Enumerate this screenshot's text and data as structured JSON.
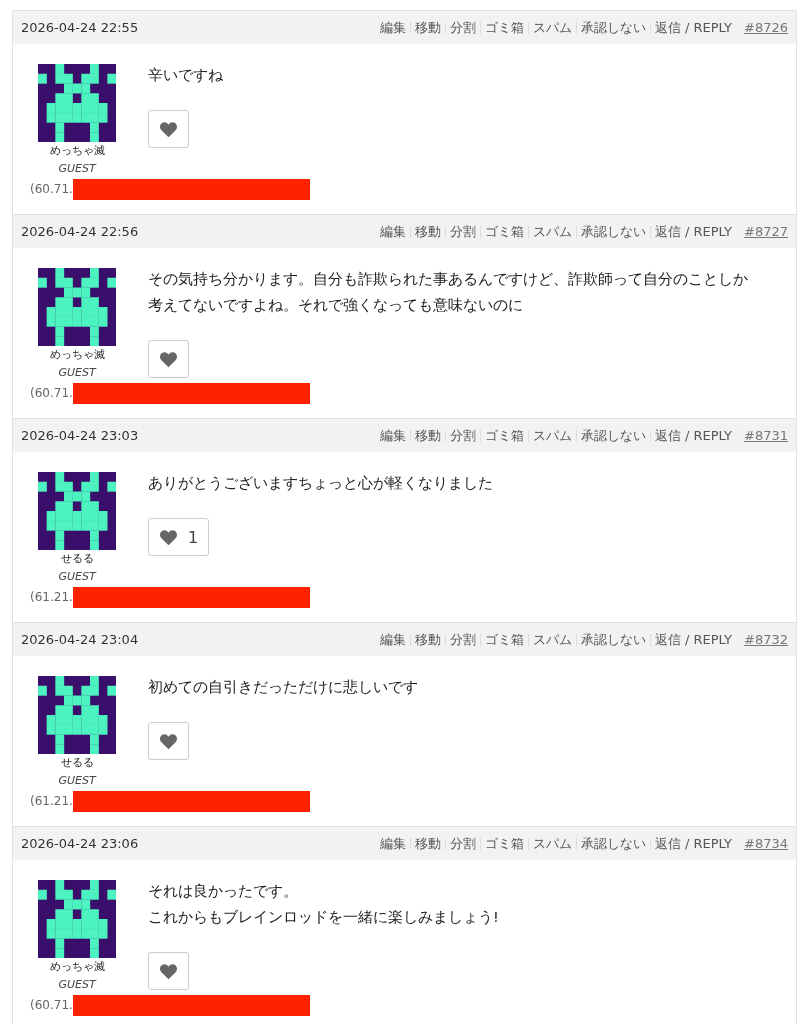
{
  "comments": [
    {
      "date": "2026-04-24 22:55",
      "actions": [
        "編集",
        "移動",
        "分割",
        "ゴミ箱",
        "スパム",
        "承認しない",
        "返信 / REPLY"
      ],
      "number": "#8726",
      "body": [
        "辛いですね"
      ],
      "author": "めっちゃ滅",
      "role": "GUEST",
      "ip": "(60.71."
    },
    {
      "date": "2026-04-24 22:56",
      "actions": [
        "編集",
        "移動",
        "分割",
        "ゴミ箱",
        "スパム",
        "承認しない",
        "返信 / REPLY"
      ],
      "number": "#8727",
      "body": [
        "その気持ち分かります。自分も詐欺られた事あるんですけど、詐欺師って自分のことしか考えてないですよね。それで強くなっても意味ないのに"
      ],
      "author": "めっちゃ滅",
      "role": "GUEST",
      "ip": "(60.71."
    },
    {
      "date": "2026-04-24 23:03",
      "actions": [
        "編集",
        "移動",
        "分割",
        "ゴミ箱",
        "スパム",
        "承認しない",
        "返信 / REPLY"
      ],
      "number": "#8731",
      "body": [
        "ありがとうございますちょっと心が軽くなりました"
      ],
      "likes": "1",
      "author": "せるる",
      "role": "GUEST",
      "ip": "(61.21."
    },
    {
      "date": "2026-04-24 23:04",
      "actions": [
        "編集",
        "移動",
        "分割",
        "ゴミ箱",
        "スパム",
        "承認しない",
        "返信 / REPLY"
      ],
      "number": "#8732",
      "body": [
        "初めての自引きだっただけに悲しいです"
      ],
      "author": "せるる",
      "role": "GUEST",
      "ip": "(61.21."
    },
    {
      "date": "2026-04-24 23:06",
      "actions": [
        "編集",
        "移動",
        "分割",
        "ゴミ箱",
        "スパム",
        "承認しない",
        "返信 / REPLY"
      ],
      "number": "#8734",
      "body": [
        "それは良かったです。",
        "これからもブレインロッドを一緒に楽しみましょう!"
      ],
      "author": "めっちゃ滅",
      "role": "GUEST",
      "ip": "(60.71."
    }
  ]
}
